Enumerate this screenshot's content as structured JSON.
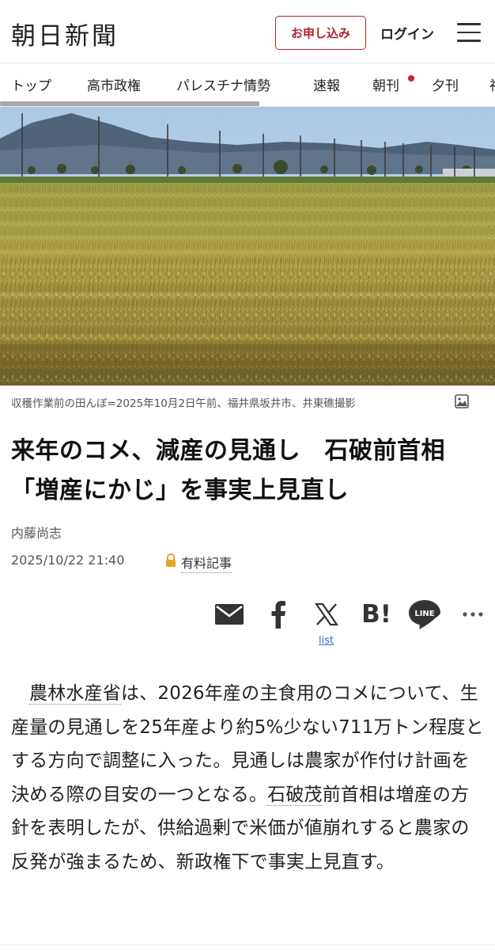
{
  "header": {
    "logo": "朝日新聞",
    "signup_label": "お申し込み",
    "login_label": "ログイン",
    "menu_icon": "hamburger-menu-icon",
    "accent_color": "#b0232a"
  },
  "nav": {
    "items": [
      {
        "label": "トップ"
      },
      {
        "label": "高市政権"
      },
      {
        "label": "パレスチナ情勢"
      },
      {
        "label": "速報"
      },
      {
        "label": "朝刊",
        "has_badge": true
      },
      {
        "label": "夕刊"
      },
      {
        "label": "社"
      }
    ],
    "badge_color": "#c8262d"
  },
  "hero": {
    "caption": "収穫作業前の田んぼ=2025年10月2日午前、福井県坂井市、井東礁撮影",
    "caption_icon": "gallery-icon"
  },
  "article": {
    "title": "来年のコメ、減産の見通し　石破前首相「増産にかじ」を事実上見直し",
    "author": "内藤尚志",
    "datetime": "2025/10/22 21:40",
    "paid_label": "有料記事",
    "lock_icon": "lock-icon"
  },
  "share": {
    "icons": [
      "mail-icon",
      "facebook-icon",
      "x-icon",
      "hatena-bookmark-icon",
      "line-icon",
      "more-icon"
    ],
    "hatena_label": "B!",
    "line_label": "LINE",
    "list_label": "list"
  },
  "body": {
    "link1": "農林水産省",
    "text1": "は、2026年産の主食用のコメについて、生産量の見通しを25年産より約5%少ない711万トン程度とする方向で調整に入った。見通しは農家が作付け計画を決める際の目安の一つとなる。",
    "link2": "石破茂",
    "text2": "前首相は増産の方針を表明したが、供給過剰で米価が値崩れすると農家の反発が強まるため、新政権下で事実上見直す。"
  }
}
